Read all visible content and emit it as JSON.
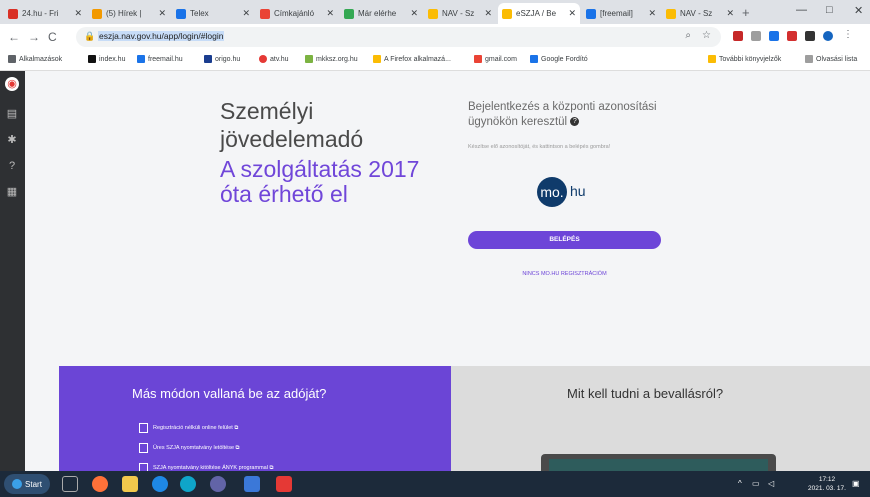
{
  "browser": {
    "tabs": [
      {
        "label": "24.hu - Fri",
        "color": "#d93025",
        "active": false
      },
      {
        "label": "(5) Hírek |",
        "color": "#f29900",
        "active": false
      },
      {
        "label": "Telex",
        "color": "#1a73e8",
        "active": false
      },
      {
        "label": "Címkajánló",
        "color": "#ea4335",
        "active": false
      },
      {
        "label": "Már elérhe",
        "color": "#34a853",
        "active": false
      },
      {
        "label": "NAV - Sz",
        "color": "#fbbc04",
        "active": false
      },
      {
        "label": "eSZJA / Be",
        "color": "#fbbc04",
        "active": true
      },
      {
        "label": "[freemail]",
        "color": "#1a73e8",
        "active": false
      },
      {
        "label": "NAV - Sz",
        "color": "#fbbc04",
        "active": false
      }
    ],
    "url": "eszja.nav.gov.hu/app/login/#login",
    "nav": {
      "back": "←",
      "forward": "→",
      "reload": "C",
      "new_tab": "+"
    },
    "window_controls": {
      "minimize": "—",
      "maximize": "□",
      "close": "✕"
    }
  },
  "bookmarks": {
    "items": [
      {
        "label": "Alkalmazások",
        "color": "#5f6368"
      },
      {
        "label": "index.hu",
        "color": "#111111"
      },
      {
        "label": "freemail.hu",
        "color": "#1a73e8"
      },
      {
        "label": "origo.hu",
        "color": "#1a3d8f"
      },
      {
        "label": "atv.hu",
        "color": "#e53935"
      },
      {
        "label": "mkksz.org.hu",
        "color": "#7cb342"
      },
      {
        "label": "A Firefox alkalmazá...",
        "color": "#fbbc04"
      },
      {
        "label": "gmail.com",
        "color": "#ea4335"
      },
      {
        "label": "Google Fordító",
        "color": "#1a73e8"
      }
    ],
    "other_bookmarks": "További könyvjelzők",
    "reading_list": "Olvasási lista"
  },
  "hero": {
    "line1": "Személyi",
    "line2": "jövedelemadó",
    "line3": "A szolgáltatás 2017",
    "line4": "óta érhető el"
  },
  "login": {
    "title": "Bejelentkezés a központi azonosítási ügynökön keresztül",
    "help_icon": "?",
    "description": "Készítse elő azonosítóját, és kattintson a belépés gombra!",
    "logo_circle": "mo.",
    "logo_text": "hu",
    "button": "BELÉPÉS",
    "register_link": "NINCS MO.HU REGISZTRÁCIÓM"
  },
  "other_ways": {
    "title": "Más módon vallaná be az adóját?",
    "items": [
      "Regisztráció nélküli online felület ⧉",
      "Üres SZJA nyomtatvány letöltése ⧉",
      "SZJA nyomtatvány kitöltése ÁNYK programmal ⧉"
    ]
  },
  "info": {
    "title": "Mit kell tudni a bevallásról?"
  },
  "taskbar": {
    "start": "Start",
    "time": "17:12",
    "date": "2021. 03. 17."
  },
  "colors": {
    "accent": "#6d45d8",
    "hero_purple": "#7046d9",
    "sidebar": "#2e3033",
    "taskbar": "#1c2a3a"
  }
}
